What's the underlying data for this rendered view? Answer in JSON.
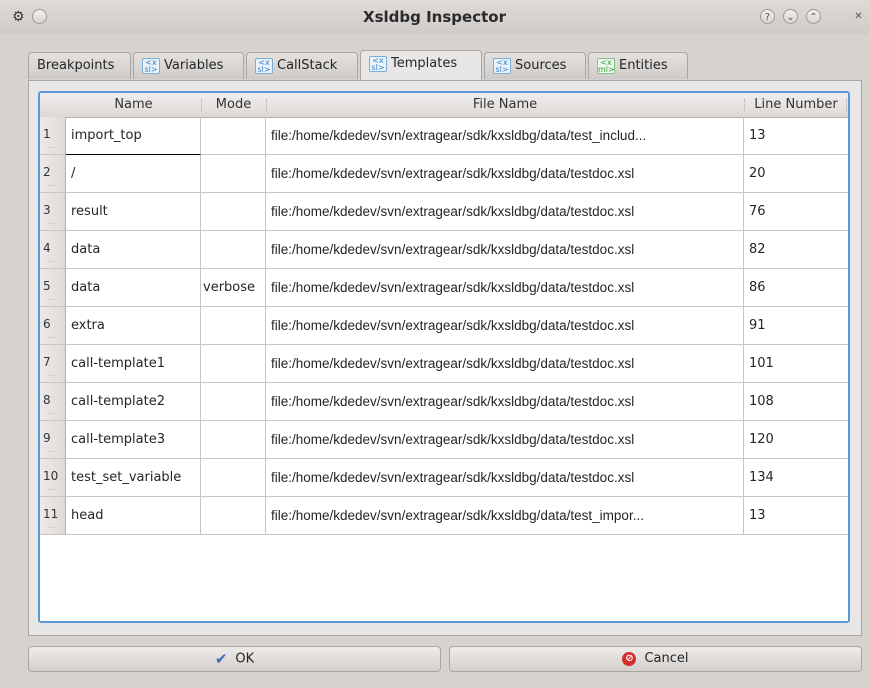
{
  "window": {
    "title": "Xsldbg Inspector"
  },
  "tabs": [
    {
      "label": "Breakpoints",
      "icon": ""
    },
    {
      "label": "Variables",
      "icon": "xsl-icon"
    },
    {
      "label": "CallStack",
      "icon": "xsl-icon"
    },
    {
      "label": "Templates",
      "icon": "xsl-icon"
    },
    {
      "label": "Sources",
      "icon": "xsl-icon"
    },
    {
      "label": "Entities",
      "icon": "xml-icon"
    }
  ],
  "active_tab": "Templates",
  "table": {
    "columns": [
      "Name",
      "Mode",
      "File Name",
      "Line Number"
    ],
    "rows": [
      {
        "num": "1",
        "name": "import_top",
        "mode": "",
        "file": "file:/home/kdedev/svn/extragear/sdk/kxsldbg/data/test_includ...",
        "line": "13"
      },
      {
        "num": "2",
        "name": "/",
        "mode": "",
        "file": "file:/home/kdedev/svn/extragear/sdk/kxsldbg/data/testdoc.xsl",
        "line": "20"
      },
      {
        "num": "3",
        "name": "result",
        "mode": "",
        "file": "file:/home/kdedev/svn/extragear/sdk/kxsldbg/data/testdoc.xsl",
        "line": "76"
      },
      {
        "num": "4",
        "name": "data",
        "mode": "",
        "file": "file:/home/kdedev/svn/extragear/sdk/kxsldbg/data/testdoc.xsl",
        "line": "82"
      },
      {
        "num": "5",
        "name": "data",
        "mode": "verbose",
        "file": "file:/home/kdedev/svn/extragear/sdk/kxsldbg/data/testdoc.xsl",
        "line": "86"
      },
      {
        "num": "6",
        "name": "extra",
        "mode": "",
        "file": "file:/home/kdedev/svn/extragear/sdk/kxsldbg/data/testdoc.xsl",
        "line": "91"
      },
      {
        "num": "7",
        "name": "call-template1",
        "mode": "",
        "file": "file:/home/kdedev/svn/extragear/sdk/kxsldbg/data/testdoc.xsl",
        "line": "101"
      },
      {
        "num": "8",
        "name": "call-template2",
        "mode": "",
        "file": "file:/home/kdedev/svn/extragear/sdk/kxsldbg/data/testdoc.xsl",
        "line": "108"
      },
      {
        "num": "9",
        "name": "call-template3",
        "mode": "",
        "file": "file:/home/kdedev/svn/extragear/sdk/kxsldbg/data/testdoc.xsl",
        "line": "120"
      },
      {
        "num": "10",
        "name": "test_set_variable",
        "mode": "",
        "file": "file:/home/kdedev/svn/extragear/sdk/kxsldbg/data/testdoc.xsl",
        "line": "134"
      },
      {
        "num": "11",
        "name": "head",
        "mode": "",
        "file": "file:/home/kdedev/svn/extragear/sdk/kxsldbg/data/test_impor...",
        "line": "13"
      }
    ]
  },
  "buttons": {
    "ok": "OK",
    "cancel": "Cancel"
  },
  "colors": {
    "focus_border": "#5a9bd6",
    "cancel_icon": "#d62c2c"
  }
}
